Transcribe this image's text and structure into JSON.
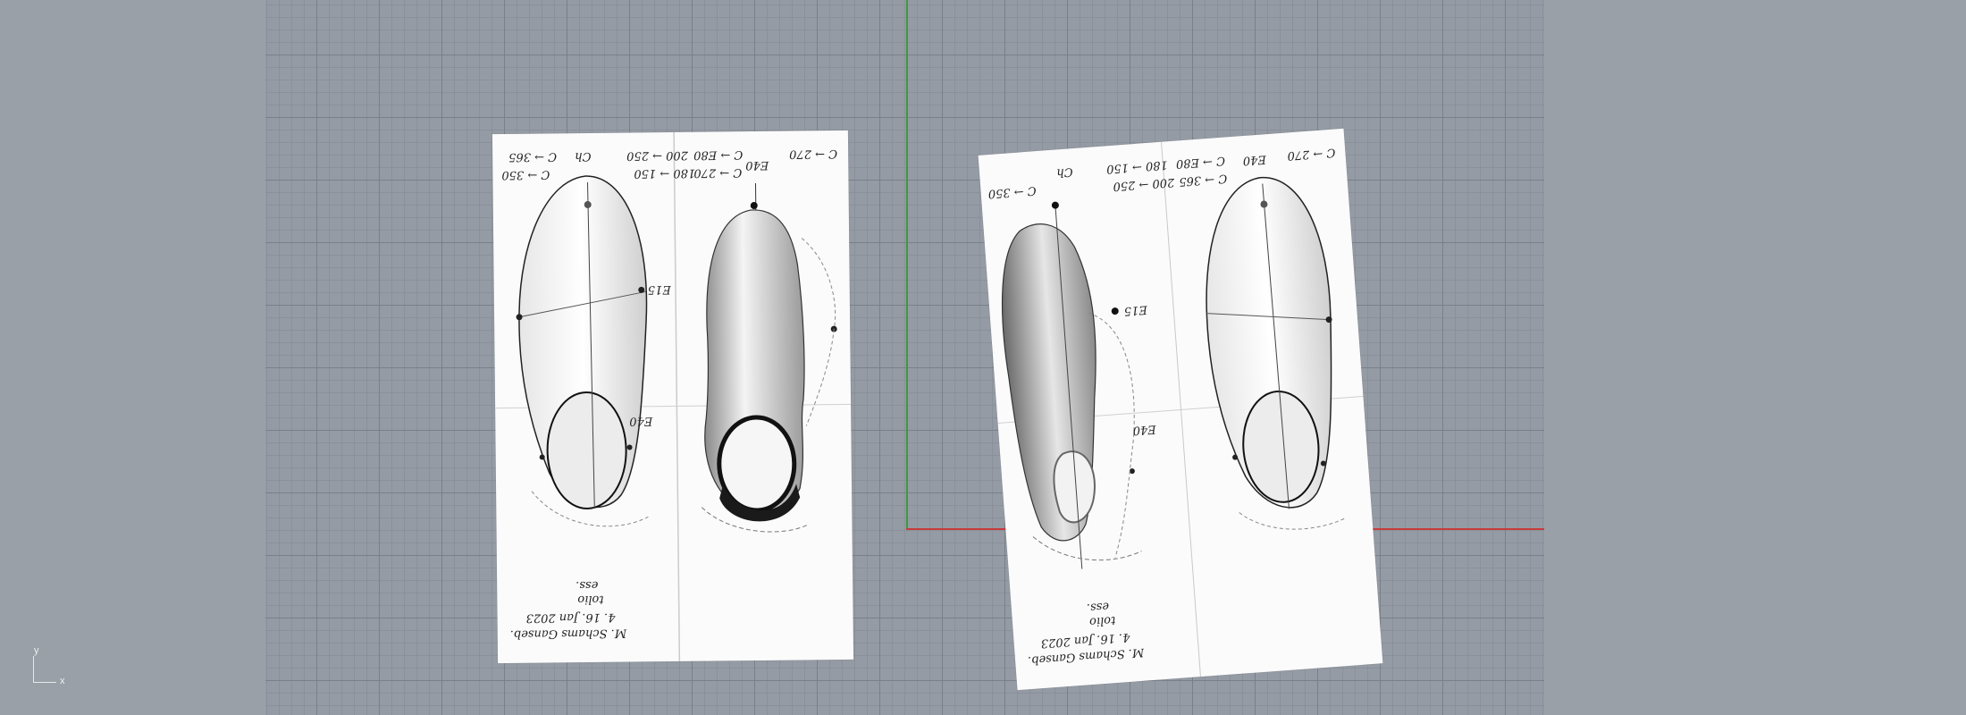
{
  "viewport": {
    "axis_labels": {
      "y": "y",
      "x": "x"
    },
    "colors": {
      "background": "#9aa0a8",
      "grid": "#959ba4",
      "x_axis": "#c83a3a",
      "y_axis": "#3d9a3d"
    }
  },
  "left_sheet": {
    "notes": {
      "c_350": "C → 350",
      "c_365": "C → 365",
      "ch": "Ch",
      "e40": "E40",
      "a": "200 → 250",
      "b": "180 → 150",
      "c_e80": "C → E80",
      "c_270": "C → 270",
      "e40_mid": "E40",
      "e15": "E15",
      "sig1": "M. Schams Ganseb.",
      "sig2": "4. 16. Jan 2023",
      "sig3": "tolio",
      "sig4": "ess."
    }
  },
  "right_sheet": {
    "notes": {
      "c_350": "C → 350",
      "c_365": "C → 365",
      "ch": "Ch",
      "e40": "E40",
      "a": "200 → 250",
      "b": "180 → 150",
      "c_e80": "C → E80",
      "c_270": "C → 270",
      "e40_mid": "E40",
      "e15": "E15",
      "sig1": "M. Schams Ganseb.",
      "sig2": "4. 16. Jan 2023",
      "sig3": "tolio",
      "sig4": "ess."
    }
  }
}
